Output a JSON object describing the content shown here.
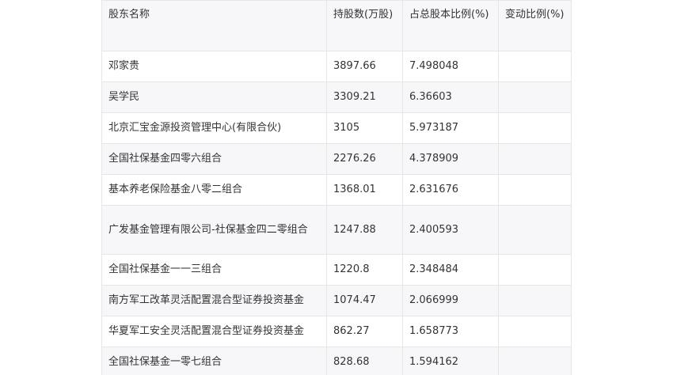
{
  "table": {
    "headers": [
      "股东名称",
      "持股数(万股)",
      "占总股本比例(%)",
      "变动比例(%)"
    ],
    "rows": [
      [
        "邓家贵",
        "3897.66",
        "7.498048",
        ""
      ],
      [
        "吴学民",
        "3309.21",
        "6.36603",
        ""
      ],
      [
        "北京汇宝金源投资管理中心(有限合伙)",
        "3105",
        "5.973187",
        ""
      ],
      [
        "全国社保基金四零六组合",
        "2276.26",
        "4.378909",
        ""
      ],
      [
        "基本养老保险基金八零二组合",
        "1368.01",
        "2.631676",
        ""
      ],
      [
        "广发基金管理有限公司-社保基金四二零组合",
        "1247.88",
        "2.400593",
        ""
      ],
      [
        "全国社保基金一一三组合",
        "1220.8",
        "2.348484",
        ""
      ],
      [
        "南方军工改革灵活配置混合型证券投资基金",
        "1074.47",
        "2.066999",
        ""
      ],
      [
        "华夏军工安全灵活配置混合型证券投资基金",
        "862.27",
        "1.658773",
        ""
      ],
      [
        "全国社保基金一零七组合",
        "828.68",
        "1.594162",
        ""
      ]
    ]
  }
}
